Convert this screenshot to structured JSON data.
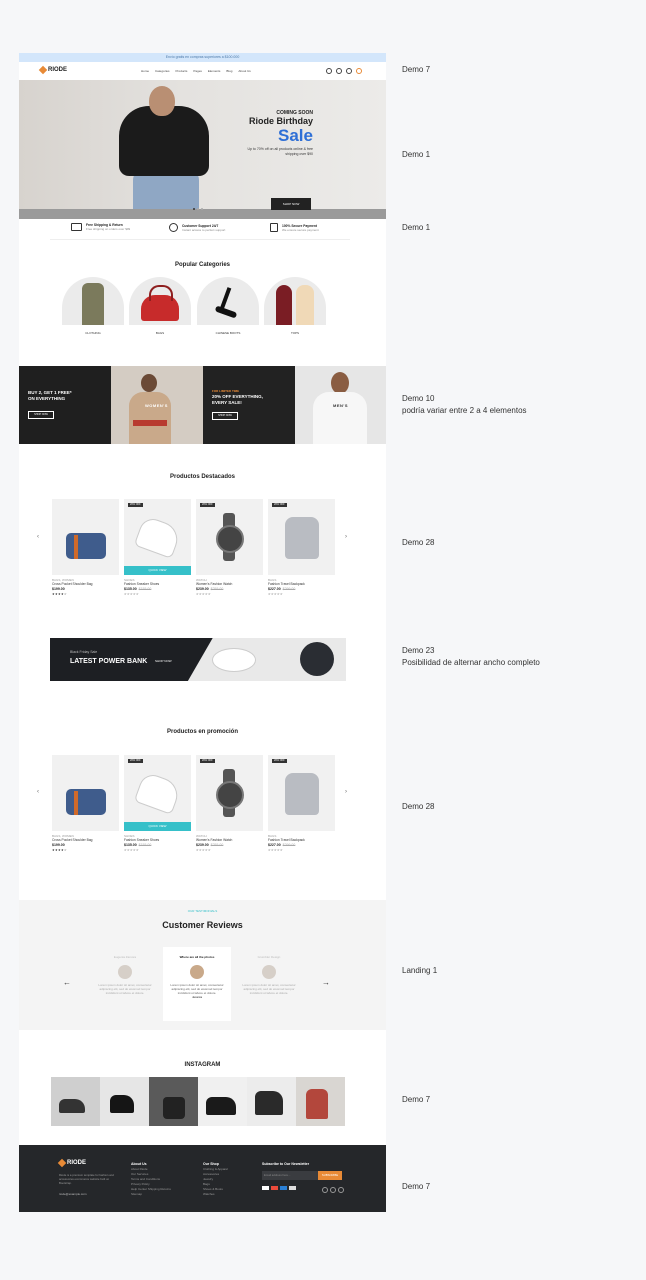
{
  "topbar": {
    "text": "Envío gratis en compras superiores a $100.000"
  },
  "header": {
    "brand": "RIODE",
    "nav": [
      "Home",
      "Categories",
      "Products",
      "Pages",
      "Elements",
      "Blog",
      "About Us"
    ]
  },
  "hero": {
    "kicker": "COMING SOON",
    "title": "Riode Birthday",
    "highlight": "Sale",
    "subtitle": "Up to 70% off on all products online & free shipping over $90",
    "button": "SHOP NOW"
  },
  "features": [
    {
      "title": "Free Shipping & Return",
      "sub": "Free shipping on orders over $99"
    },
    {
      "title": "Customer Support 24/7",
      "sub": "Instant access to perfect support"
    },
    {
      "title": "100% Secure Payment",
      "sub": "We ensure secure payment"
    }
  ],
  "categories": {
    "title": "Popular Categories",
    "items": [
      "CLOTHING",
      "BAGS",
      "CHINESE BOOTS",
      "TOPS"
    ]
  },
  "banners": {
    "b1_line1": "BUY 2, GET 1 FREE*",
    "b1_line2": "ON EVERYTHING",
    "b1_btn": "SHOP NOW",
    "women": "WOMEN'S",
    "b3_kicker": "FOR LIMITED TIME",
    "b3_line1": "20% OFF EVERYTHING,",
    "b3_line2": "EVERY SALE!",
    "b3_btn": "SHOP NOW",
    "men": "MEN'S"
  },
  "featured": {
    "title": "Productos Destacados",
    "products": [
      {
        "cat": "BAGS, WOMEN",
        "name": "Cross Pocket Shoulder Bag",
        "price": "$199.00",
        "old": "",
        "badge": ""
      },
      {
        "cat": "SHOES",
        "name": "Fashion Sneaker Shoes",
        "price": "$135.00",
        "old": "$155.00",
        "badge": "20% OFF",
        "qv": "QUICK VIEW"
      },
      {
        "cat": "WATCH",
        "name": "Women's Fashion Watch",
        "price": "$239.00",
        "old": "$255.00",
        "badge": "20% OFF"
      },
      {
        "cat": "BAGS",
        "name": "Fashion Travel Backpack",
        "price": "$227.00",
        "old": "$299.00",
        "badge": "20% OFF"
      }
    ]
  },
  "promo": {
    "kicker": "Black Friday Sale",
    "title": "LATEST POWER BANK",
    "btn": "SHOP NOW"
  },
  "sale": {
    "title": "Productos en promoción",
    "products": [
      {
        "cat": "BAGS, WOMEN",
        "name": "Cross Pocket Shoulder Bag",
        "price": "$199.00",
        "old": "",
        "badge": ""
      },
      {
        "cat": "SHOES",
        "name": "Fashion Sneaker Shoes",
        "price": "$135.00",
        "old": "$155.00",
        "badge": "20% OFF",
        "qv": "QUICK VIEW"
      },
      {
        "cat": "WATCH",
        "name": "Women's Fashion Watch",
        "price": "$239.00",
        "old": "$255.00",
        "badge": "20% OFF"
      },
      {
        "cat": "BAGS",
        "name": "Fashion Travel Backpack",
        "price": "$227.00",
        "old": "$299.00",
        "badge": "20% OFF"
      }
    ]
  },
  "reviews": {
    "kicker": "OUR TESTIMONIALS",
    "title": "Customer Reviews",
    "cards": [
      {
        "name": "Eugenia Zamora",
        "head": "",
        "text": "Lorem ipsum dolor sit amet, consectetur adipiscing elit, sed do eiusmod tempor incididunt ut labore et dolore."
      },
      {
        "name": "Jessica",
        "head": "Where are all the photos",
        "text": "Lorem ipsum dolor sit amet, consectetur adipiscing elit, sed do eiusmod tempor incididunt ut labore et dolore."
      },
      {
        "name": "Grumbler Design",
        "head": "",
        "text": "Lorem ipsum dolor sit amet, consectetur adipiscing elit, sed do eiusmod tempor incididunt ut labore et dolore."
      }
    ]
  },
  "instagram": {
    "title": "INSTAGRAM"
  },
  "footer": {
    "brand": "RIODE",
    "about": "Riode is a premium template for fashion and accessories ecommerce website built on Bootstrap.",
    "contact": "riode@example.com",
    "col1": {
      "title": "About Us",
      "items": [
        "About Riode",
        "Our Services",
        "Terms and Conditions",
        "Privacy Policy",
        "Help Center Shipping Returns",
        "Sitemap"
      ]
    },
    "col2": {
      "title": "Our Shop",
      "items": [
        "Clothing & Apparel",
        "Accessories",
        "Jewelry",
        "Bags",
        "Shoes & Boots",
        "Watches"
      ]
    },
    "newsletter": {
      "title": "Subscribe to Our Newsletter",
      "placeholder": "Email address here...",
      "btn": "SUBSCRIBE"
    }
  },
  "notes": [
    {
      "text": "Demo 7"
    },
    {
      "text": "Demo 1"
    },
    {
      "text": "Demo 1"
    },
    {
      "text": "Demo 10"
    },
    {
      "text": "podría variar entre 2 a 4 elementos"
    },
    {
      "text": "Demo 28"
    },
    {
      "text": "Demo 23"
    },
    {
      "text": "Posibilidad de alternar ancho completo"
    },
    {
      "text": "Demo 28"
    },
    {
      "text": "Landing 1"
    },
    {
      "text": "Demo 7"
    },
    {
      "text": "Demo 7"
    }
  ],
  "colors": {
    "accent": "#e88a36",
    "sale_blue": "#2e6fd6",
    "teal": "#36c0c9",
    "footer": "#25272a"
  }
}
